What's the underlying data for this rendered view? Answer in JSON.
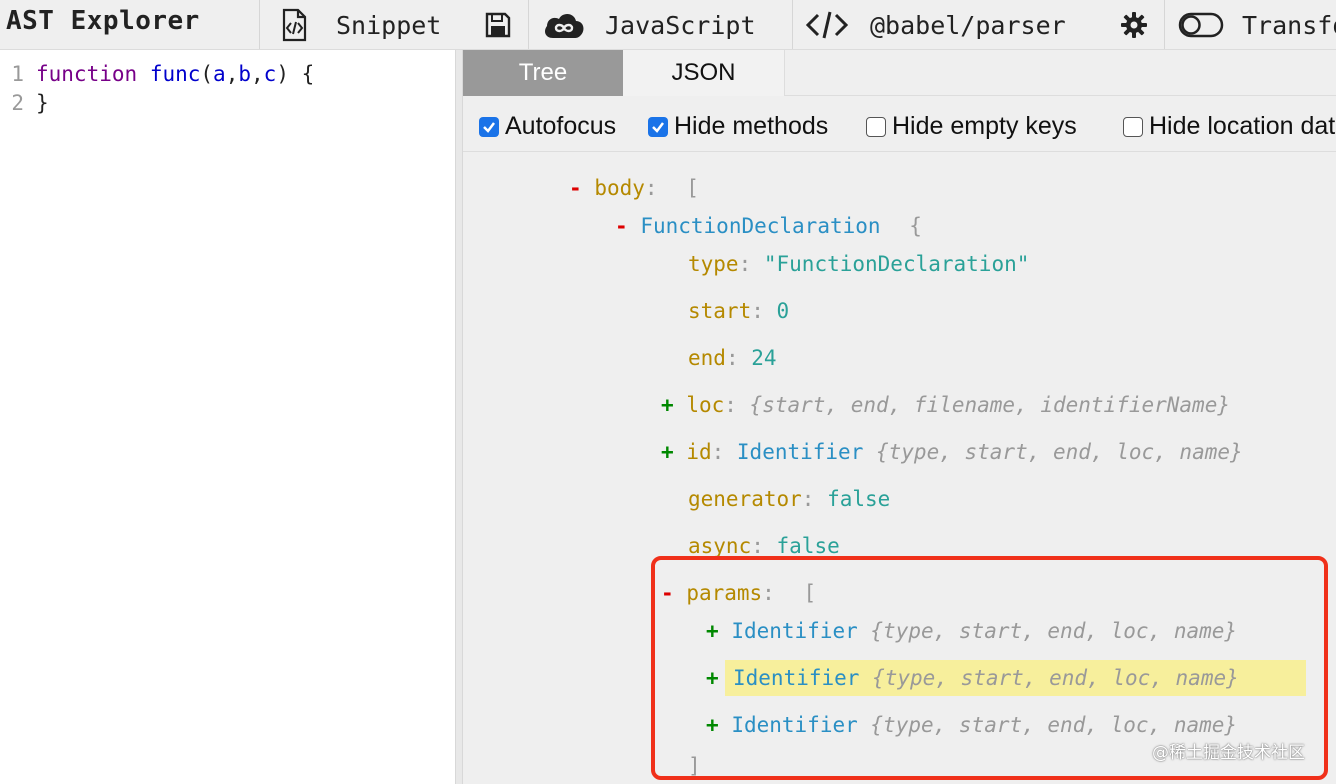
{
  "toolbar": {
    "title": "AST Explorer",
    "snippet_label": "Snippet",
    "language_label": "JavaScript",
    "parser_label": "@babel/parser",
    "transform_label": "Transform"
  },
  "editor": {
    "lines": [
      {
        "num": "1",
        "tokens": [
          {
            "t": "function",
            "c": "kw"
          },
          {
            "t": " ",
            "c": "pn"
          },
          {
            "t": "func",
            "c": "fn"
          },
          {
            "t": "(",
            "c": "pn"
          },
          {
            "t": "a",
            "c": "vr"
          },
          {
            "t": ",",
            "c": "pn"
          },
          {
            "t": "b",
            "c": "vr"
          },
          {
            "t": ",",
            "c": "pn"
          },
          {
            "t": "c",
            "c": "vr"
          },
          {
            "t": ") {",
            "c": "pn"
          }
        ]
      },
      {
        "num": "2",
        "tokens": [
          {
            "t": "}",
            "c": "pn"
          }
        ]
      }
    ]
  },
  "panel": {
    "tabs": [
      {
        "label": "Tree",
        "active": true
      },
      {
        "label": "JSON",
        "active": false
      }
    ],
    "options": [
      {
        "label": "Autofocus",
        "checked": true
      },
      {
        "label": "Hide methods",
        "checked": true
      },
      {
        "label": "Hide empty keys",
        "checked": false
      },
      {
        "label": "Hide location data",
        "checked": false
      }
    ]
  },
  "tree": {
    "body_key": "body",
    "body_bracket": "[",
    "fd_type": "FunctionDeclaration",
    "fd_brace": "{",
    "type_key": "type",
    "type_value": "\"FunctionDeclaration\"",
    "start_key": "start",
    "start_value": "0",
    "end_key": "end",
    "end_value": "24",
    "loc_key": "loc",
    "loc_summary": "{start, end, filename, identifierName}",
    "id_key": "id",
    "id_type": "Identifier",
    "id_summary": "{type, start, end, loc, name}",
    "generator_key": "generator",
    "generator_value": "false",
    "async_key": "async",
    "async_value": "false",
    "params_key": "params",
    "params_bracket": "[",
    "params": [
      {
        "type": "Identifier",
        "summary": "{type, start, end, loc, name}",
        "highlighted": false
      },
      {
        "type": "Identifier",
        "summary": "{type, start, end, loc, name}",
        "highlighted": true
      },
      {
        "type": "Identifier",
        "summary": "{type, start, end, loc, name}",
        "highlighted": false
      }
    ],
    "params_close": "]"
  },
  "watermark": "@稀土掘金技术社区",
  "colors": {
    "highlight_box": "#f0301a",
    "checkbox": "#1a73e8"
  }
}
